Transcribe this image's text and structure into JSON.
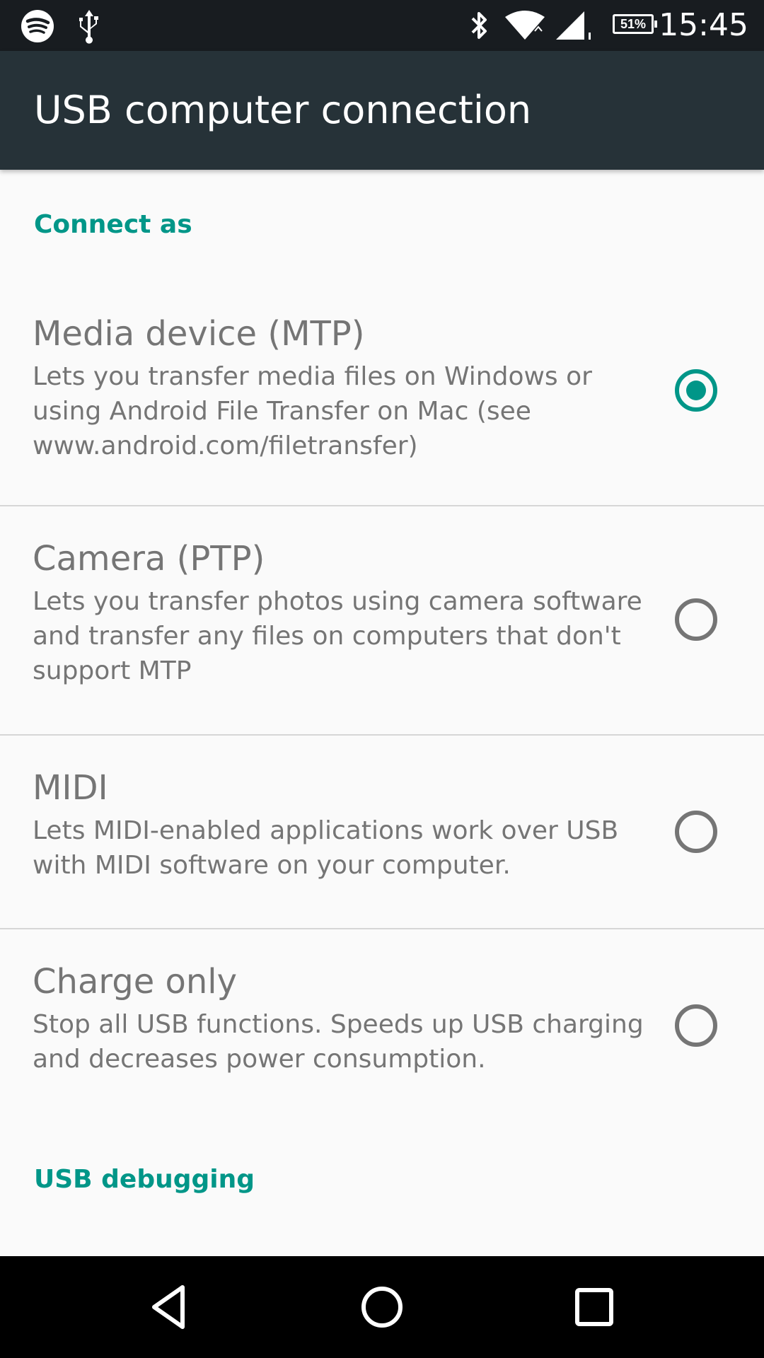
{
  "status_bar": {
    "time": "15:45",
    "battery": "51%",
    "icons": [
      "spotify-icon",
      "usb-icon",
      "bluetooth-icon",
      "wifi-icon",
      "cell-signal-icon",
      "battery-icon"
    ]
  },
  "app_bar": {
    "title": "USB computer connection"
  },
  "sections": {
    "connect_as": "Connect as",
    "usb_debugging": "USB debugging"
  },
  "options": [
    {
      "title": "Media device (MTP)",
      "summary": "Lets you transfer media files on Windows or using Android File Transfer on Mac (see www.android.com/filetransfer)",
      "selected": true
    },
    {
      "title": "Camera (PTP)",
      "summary": "Lets you transfer photos using camera software and transfer any files on computers that don't support MTP",
      "selected": false
    },
    {
      "title": "MIDI",
      "summary": "Lets MIDI-enabled applications work over USB with MIDI software on your computer.",
      "selected": false
    },
    {
      "title": "Charge only",
      "summary": "Stop all USB functions. Speeds up USB charging and decreases power consumption.",
      "selected": false
    }
  ],
  "colors": {
    "accent": "#009688",
    "app_bar": "#263238",
    "status_bar": "#181c20",
    "text_secondary": "#757575",
    "background": "#fafafa"
  },
  "nav_bar": {
    "icons": [
      "back-icon",
      "home-icon",
      "recents-icon"
    ]
  }
}
